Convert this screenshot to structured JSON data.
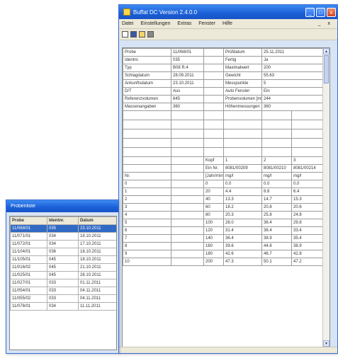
{
  "main_window": {
    "title": "Buffat DC Version 2.4.0.0",
    "menu": [
      "Datei",
      "Einstellungen",
      "Extras",
      "Fenster",
      "Hilfe"
    ],
    "controls": {
      "minimize": "_",
      "maximize": "□",
      "close": "x",
      "menu_min": "_",
      "menu_close": "x"
    },
    "properties": [
      {
        "label": "Probe",
        "value": "11/068/01",
        "label2": "Prüfdatum",
        "value2": "25.11.2011"
      },
      {
        "label": "Identnr.",
        "value": "035",
        "label2": "Fertig",
        "value2": "Ja"
      },
      {
        "label": "Typ",
        "value": "B08 R.4",
        "label2": "Maximalwert",
        "value2": "200"
      },
      {
        "label": "Schlagdatum",
        "value": "28.09.2011",
        "label2": "Gewicht",
        "value2": "55.63"
      },
      {
        "label": "Ankunftsdatum",
        "value": "23.10.2011",
        "label2": "Messpunkte",
        "value2": "5"
      },
      {
        "label": "D/T",
        "value": "Aus",
        "label2": "Auto Fenster",
        "value2": "Ein"
      },
      {
        "label": "Referenzvolumen",
        "value": "645",
        "label2": "Probenvolumen [ml]",
        "value2": "244"
      },
      {
        "label": "Massenangaben",
        "value": "360",
        "label2": "Höhenmessungen",
        "value2": "360"
      }
    ],
    "table_header": {
      "row1": [
        "",
        "",
        "Kopf",
        "1",
        "2",
        "3"
      ],
      "row2": [
        "",
        "",
        "Ein Nr.",
        "8081/00209",
        "8081/00210",
        "8081/00214"
      ],
      "row3": [
        "Nr.",
        "",
        "[Jahr/min]",
        "mg/l",
        "mg/l",
        "mg/l"
      ]
    },
    "table_rows": [
      [
        "0",
        "0",
        "0.0",
        "0.0",
        "0.0"
      ],
      [
        "1",
        "20",
        "4.4",
        "8.8",
        "6.4"
      ],
      [
        "2",
        "40",
        "13.3",
        "14.7",
        "15.3"
      ],
      [
        "3",
        "60",
        "18.2",
        "20.8",
        "20.6"
      ],
      [
        "4",
        "80",
        "20.3",
        "25.8",
        "24.8"
      ],
      [
        "5",
        "100",
        "28.0",
        "36.4",
        "29.8"
      ],
      [
        "6",
        "120",
        "31.4",
        "38.4",
        "33.4"
      ],
      [
        "7",
        "140",
        "36.4",
        "38.9",
        "35.4"
      ],
      [
        "8",
        "160",
        "39.6",
        "44.8",
        "38.9"
      ],
      [
        "9",
        "180",
        "42.6",
        "46.7",
        "42.8"
      ],
      [
        "10",
        "200",
        "47.3",
        "50.1",
        "47.2"
      ]
    ]
  },
  "list_window": {
    "title": "Probenliste",
    "columns": [
      "Probe",
      "Identnr.",
      "Datum"
    ],
    "rows": [
      [
        "11/068/01",
        "035",
        "23.10.2011"
      ],
      [
        "11/071/01",
        "034",
        "18.10.2011"
      ],
      [
        "11/072/01",
        "034",
        "17.10.2011"
      ],
      [
        "11/104/01",
        "036",
        "18.10.2011"
      ],
      [
        "11/105/01",
        "045",
        "18.10.2011"
      ],
      [
        "11/016/02",
        "045",
        "21.10.2011"
      ],
      [
        "11/025/01",
        "045",
        "28.10.2011"
      ],
      [
        "11/027/01",
        "033",
        "01.11.2011"
      ],
      [
        "11/054/01",
        "033",
        "04.11.2011"
      ],
      [
        "11/055/02",
        "033",
        "04.11.2011"
      ],
      [
        "11/076/01",
        "034",
        "11.11.2011"
      ]
    ],
    "selected_index": 0
  }
}
